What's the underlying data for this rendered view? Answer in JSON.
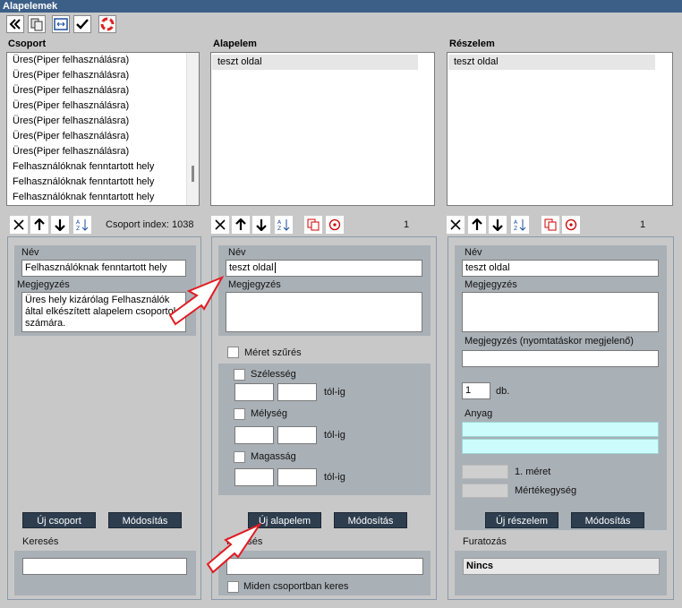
{
  "window": {
    "title": "Alapelemek"
  },
  "toolbar": {
    "icons": [
      "double-chevron-left-icon",
      "copy-pages-icon",
      "fit-window-icon",
      "checkmark-icon",
      "lifebuoy-icon"
    ]
  },
  "csoport": {
    "title": "Csoport",
    "items": [
      "Üres(Piper felhasználásra)",
      "Üres(Piper felhasználásra)",
      "Üres(Piper felhasználásra)",
      "Üres(Piper felhasználásra)",
      "Üres(Piper felhasználásra)",
      "Üres(Piper felhasználásra)",
      "Üres(Piper felhasználásra)",
      "Felhasználóknak fenntartott hely",
      "Felhasználóknak fenntartott hely",
      "Felhasználóknak fenntartott hely"
    ],
    "index_label": "Csoport index:",
    "index_value": "1038",
    "nev_label": "Név",
    "nev_value": "Felhasználóknak fenntartott hely",
    "megjegyzes_label": "Megjegyzés",
    "megjegyzes_value": "Üres hely kizárólag Felhasználók által elkészített alapelem csoportok számára.",
    "new_btn": "Új csoport",
    "modify_btn": "Módosítás",
    "search_label": "Keresés",
    "search_value": ""
  },
  "alapelem": {
    "title": "Alapelem",
    "items": [
      "teszt oldal"
    ],
    "count": "1",
    "nev_label": "Név",
    "nev_value": "teszt oldal",
    "megjegyzes_label": "Megjegyzés",
    "meret_szures_label": "Méret szűrés",
    "szelesseg_label": "Szélesség",
    "melyseg_label": "Mélység",
    "magassag_label": "Magasság",
    "tol_ig": "tól-ig",
    "new_btn": "Új alapelem",
    "modify_btn": "Módosítás",
    "search_label": "Keresés",
    "search_value": "",
    "all_groups_label": "Miden csoportban keres"
  },
  "reszelem": {
    "title": "Részelem",
    "items": [
      "teszt oldal"
    ],
    "count": "1",
    "nev_label": "Név",
    "nev_value": "teszt oldal",
    "megjegyzes_label": "Megjegyzés",
    "print_note_label": "Megjegyzés (nyomtatáskor megjelenő)",
    "qty_value": "1",
    "qty_unit": "db.",
    "anyag_label": "Anyag",
    "meret_label": "1. méret",
    "mertekegyseg_label": "Mértékegység",
    "new_btn": "Új részelem",
    "modify_btn": "Módosítás",
    "furatozas_label": "Furatozás",
    "furatozas_value": "Nincs"
  },
  "colors": {
    "titlebar": "#3c5f88",
    "button_dark": "#2e3e4f",
    "annotation_arrow": "#e11b22",
    "cyan_field": "#ccfcfc"
  }
}
